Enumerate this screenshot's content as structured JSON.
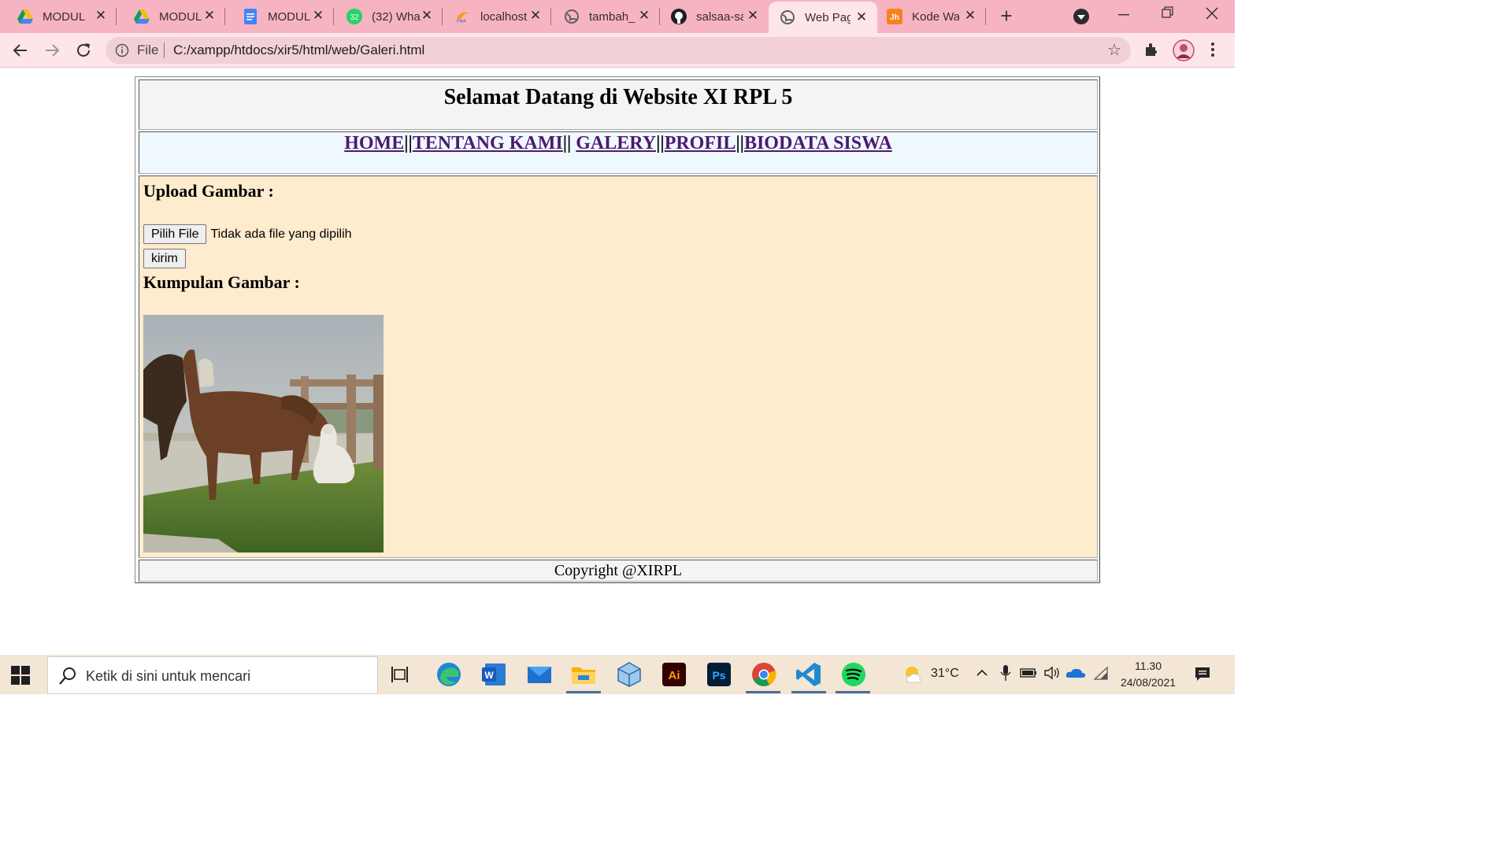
{
  "browser": {
    "tabs": [
      {
        "label": "MODUL",
        "icon": "google-drive-icon"
      },
      {
        "label": "MODUL",
        "icon": "google-drive-icon"
      },
      {
        "label": "MODUL",
        "icon": "google-docs-icon"
      },
      {
        "label": "(32) Wha",
        "icon": "whatsapp-icon"
      },
      {
        "label": "localhost",
        "icon": "phpmyadmin-icon"
      },
      {
        "label": "tambah_",
        "icon": "globe-icon"
      },
      {
        "label": "salsaa-sa",
        "icon": "github-icon"
      },
      {
        "label": "Web Pag",
        "icon": "globe-icon"
      },
      {
        "label": "Kode Wa",
        "icon": "html-icon"
      }
    ],
    "active_tab_index": 7,
    "omnibox": {
      "scheme": "File",
      "url": "C:/xampp/htdocs/xir5/html/web/Galeri.html"
    }
  },
  "page": {
    "title": "Selamat Datang di Website XI RPL 5",
    "nav": {
      "home": "HOME",
      "about": "TENTANG KAMI",
      "gallery": "GALERY",
      "profile": "PROFIL",
      "biodata": "BIODATA SISWA",
      "separator": "||"
    },
    "upload_heading": "Upload Gambar :",
    "choose_file_label": "Pilih File",
    "no_file_text": "Tidak ada file yang dipilih",
    "send_label": "kirim",
    "gallery_heading": "Kumpulan Gambar :",
    "footer": "Copyright @XIRPL"
  },
  "taskbar": {
    "search_placeholder": "Ketik di sini untuk mencari",
    "weather": "31°C",
    "time": "11.30",
    "date": "24/08/2021"
  },
  "colors": {
    "tabstrip": "#f6b4c2",
    "toolbar": "#fde5ea",
    "main_cell": "#ffebcd",
    "nav_cell": "#f0f8ff",
    "link": "#4b1a6e"
  }
}
